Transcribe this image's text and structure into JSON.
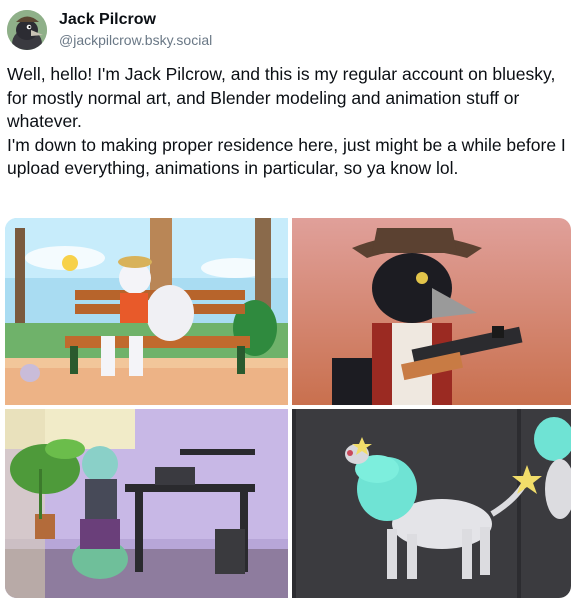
{
  "author": {
    "display_name": "Jack Pilcrow",
    "handle": "@jackpilcrow.bsky.social",
    "avatar_icon": "crow-character-avatar"
  },
  "post": {
    "paragraphs": [
      "Well, hello! I'm Jack Pilcrow, and this is my regular account on bluesky, for mostly normal art, and Blender modeling and animation stuff or whatever.",
      "I'm down to making proper residence here, just might be a while before I upload everything, animations in particular, so ya know lol."
    ]
  },
  "media": [
    {
      "name": "beach-bench-artwork"
    },
    {
      "name": "crow-gunslinger-artwork"
    },
    {
      "name": "room-desk-artwork"
    },
    {
      "name": "creature-3d-model-render"
    }
  ],
  "colors": {
    "text": "#0b0f14",
    "handle": "#6a7886",
    "avatar_bg": "#8fb089"
  }
}
